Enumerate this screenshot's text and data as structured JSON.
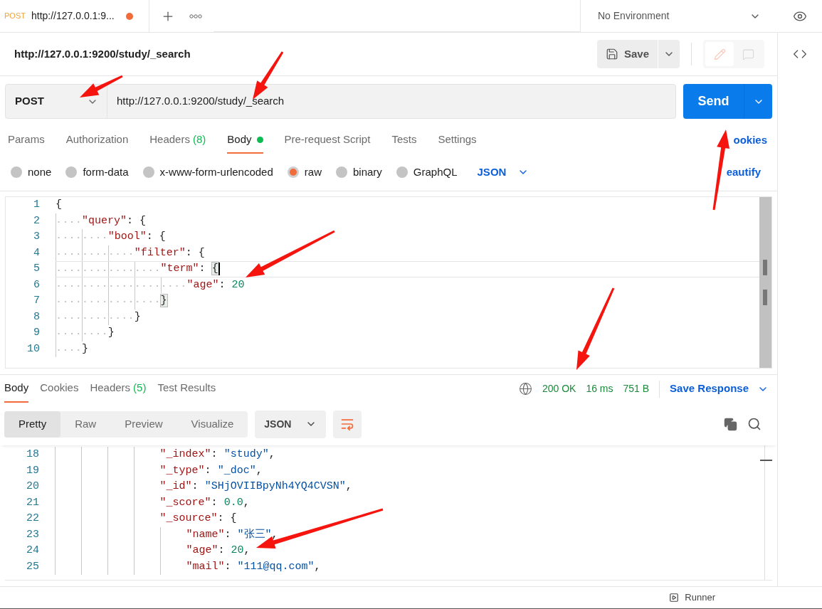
{
  "tab_bar": {
    "tabs": [
      {
        "method": "POST",
        "title": "http://127.0.0.1:9...",
        "unsaved": true,
        "selected": true
      }
    ],
    "environment": "No Environment"
  },
  "request": {
    "name": "http://127.0.0.1:9200/study/_search",
    "save_label": "Save",
    "modes": [
      {
        "kind": "edit",
        "selected": true
      },
      {
        "kind": "comment",
        "selected": false
      }
    ],
    "method": "POST",
    "url": "http://127.0.0.1:9200/study/_search",
    "send_label": "Send",
    "tabs": [
      {
        "label": "Params",
        "selected": false,
        "has_content": false
      },
      {
        "label": "Authorization",
        "selected": false,
        "has_content": false
      },
      {
        "label": "Headers",
        "count": "(8)",
        "selected": false,
        "has_content": false
      },
      {
        "label": "Body",
        "selected": true,
        "has_content": true
      },
      {
        "label": "Pre-request Script",
        "selected": false,
        "has_content": false
      },
      {
        "label": "Tests",
        "selected": false,
        "has_content": false
      },
      {
        "label": "Settings",
        "selected": false,
        "has_content": false
      }
    ],
    "cookies_link": "ookies",
    "body_types": [
      {
        "label": "none",
        "selected": false
      },
      {
        "label": "form-data",
        "selected": false
      },
      {
        "label": "x-www-form-urlencoded",
        "selected": false
      },
      {
        "label": "raw",
        "selected": true
      },
      {
        "label": "binary",
        "selected": false
      },
      {
        "label": "GraphQL",
        "selected": false
      }
    ],
    "language": "JSON",
    "beautify_link": "eautify",
    "editor": {
      "show_whitespace": true,
      "lines": [
        {
          "number": "1",
          "active": false,
          "tokens": [
            {
              "kind": "punct",
              "text": "{"
            }
          ],
          "children": [
            {
              "number": "2",
              "active": false,
              "tokens": [
                {
                  "kind": "key",
                  "text": "\"query\""
                },
                {
                  "kind": "punct",
                  "text": ": {"
                }
              ],
              "children": [
                {
                  "number": "3",
                  "active": false,
                  "tokens": [
                    {
                      "kind": "key",
                      "text": "\"bool\""
                    },
                    {
                      "kind": "punct",
                      "text": ": {"
                    }
                  ],
                  "children": [
                    {
                      "number": "4",
                      "active": false,
                      "tokens": [
                        {
                          "kind": "key",
                          "text": "\"filter\""
                        },
                        {
                          "kind": "punct",
                          "text": ": {"
                        }
                      ],
                      "children": [
                        {
                          "number": "5",
                          "active": true,
                          "tokens": [
                            {
                              "kind": "key",
                              "text": "\"term\""
                            },
                            {
                              "kind": "punct",
                              "text": ": "
                            },
                            {
                              "kind": "match",
                              "text": "{"
                            }
                          ],
                          "children": [
                            {
                              "number": "6",
                              "active": false,
                              "tokens": [
                                {
                                  "kind": "key",
                                  "text": "\"age\""
                                },
                                {
                                  "kind": "punct",
                                  "text": ": "
                                },
                                {
                                  "kind": "number",
                                  "text": "20"
                                }
                              ]
                            }
                          ]
                        },
                        {
                          "number": "7",
                          "active": false,
                          "tokens": [
                            {
                              "kind": "match",
                              "text": "}"
                            }
                          ]
                        }
                      ]
                    },
                    {
                      "number": "8",
                      "active": false,
                      "tokens": [
                        {
                          "kind": "punct",
                          "text": "}"
                        }
                      ]
                    }
                  ]
                },
                {
                  "number": "9",
                  "active": false,
                  "tokens": [
                    {
                      "kind": "punct",
                      "text": "}"
                    }
                  ]
                }
              ]
            },
            {
              "number": "10",
              "active": false,
              "tokens": [
                {
                  "kind": "punct",
                  "text": "}"
                }
              ]
            }
          ]
        }
      ]
    }
  },
  "response": {
    "tabs": [
      {
        "label": "Body",
        "selected": true
      },
      {
        "label": "Cookies",
        "selected": false
      },
      {
        "label": "Headers",
        "count": "(5)",
        "selected": false
      },
      {
        "label": "Test Results",
        "selected": false
      }
    ],
    "status": "200 OK",
    "time": "16 ms",
    "size": "751 B",
    "save_response": "Save Response",
    "views": [
      {
        "label": "Pretty",
        "selected": true
      },
      {
        "label": "Raw",
        "selected": false
      },
      {
        "label": "Preview",
        "selected": false
      },
      {
        "label": "Visualize",
        "selected": false
      }
    ],
    "format": "JSON",
    "editor": {
      "show_whitespace": false,
      "lines": [
        {
          "number": "18",
          "active": false,
          "tokens": [
            {
              "kind": "key",
              "text": "\"_index\""
            },
            {
              "kind": "punct",
              "text": ": "
            },
            {
              "kind": "string",
              "text": "\"study\""
            },
            {
              "kind": "punct",
              "text": ","
            }
          ]
        },
        {
          "number": "19",
          "active": false,
          "tokens": [
            {
              "kind": "key",
              "text": "\"_type\""
            },
            {
              "kind": "punct",
              "text": ": "
            },
            {
              "kind": "string",
              "text": "\"_doc\""
            },
            {
              "kind": "punct",
              "text": ","
            }
          ]
        },
        {
          "number": "20",
          "active": false,
          "tokens": [
            {
              "kind": "key",
              "text": "\"_id\""
            },
            {
              "kind": "punct",
              "text": ": "
            },
            {
              "kind": "string",
              "text": "\"SHjOVIIBpyNh4YQ4CVSN\""
            },
            {
              "kind": "punct",
              "text": ","
            }
          ]
        },
        {
          "number": "21",
          "active": false,
          "tokens": [
            {
              "kind": "key",
              "text": "\"_score\""
            },
            {
              "kind": "punct",
              "text": ": "
            },
            {
              "kind": "number",
              "text": "0.0"
            },
            {
              "kind": "punct",
              "text": ","
            }
          ]
        },
        {
          "number": "22",
          "active": false,
          "tokens": [
            {
              "kind": "key",
              "text": "\"_source\""
            },
            {
              "kind": "punct",
              "text": ": {"
            }
          ],
          "children": [
            {
              "number": "23",
              "active": false,
              "tokens": [
                {
                  "kind": "key",
                  "text": "\"name\""
                },
                {
                  "kind": "punct",
                  "text": ": "
                },
                {
                  "kind": "string",
                  "text": "\"张三\""
                },
                {
                  "kind": "punct",
                  "text": ","
                }
              ]
            },
            {
              "number": "24",
              "active": false,
              "tokens": [
                {
                  "kind": "key",
                  "text": "\"age\""
                },
                {
                  "kind": "punct",
                  "text": ": "
                },
                {
                  "kind": "number",
                  "text": "20"
                },
                {
                  "kind": "punct",
                  "text": ","
                }
              ]
            },
            {
              "number": "25",
              "active": false,
              "tokens": [
                {
                  "kind": "key",
                  "text": "\"mail\""
                },
                {
                  "kind": "punct",
                  "text": ": "
                },
                {
                  "kind": "string",
                  "text": "\"111@qq.com\""
                },
                {
                  "kind": "punct",
                  "text": ","
                }
              ]
            }
          ]
        }
      ]
    }
  },
  "footer": {
    "runner": "Runner"
  }
}
